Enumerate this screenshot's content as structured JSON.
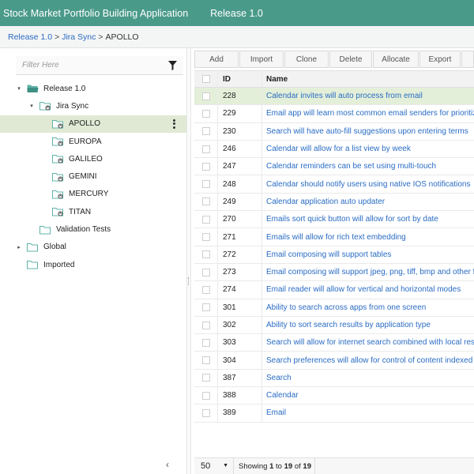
{
  "header": {
    "app_title": "Stock Market Portfolio Building Application",
    "release": "Release 1.0",
    "bg_color": "#4a9a8a"
  },
  "breadcrumb": {
    "items": [
      "Release 1.0",
      "Jira Sync"
    ],
    "separator": ">",
    "current": "APOLLO"
  },
  "filter": {
    "placeholder": "Filter Here",
    "icon": "filter-icon"
  },
  "tree": [
    {
      "label": "Release 1.0",
      "level": 0,
      "expanded": true,
      "icon": "folder-open-icon"
    },
    {
      "label": "Jira Sync",
      "level": 1,
      "expanded": true,
      "icon": "folder-sync-icon"
    },
    {
      "label": "APOLLO",
      "level": 2,
      "selected": true,
      "icon": "folder-sync-icon"
    },
    {
      "label": "EUROPA",
      "level": 2,
      "icon": "folder-sync-icon"
    },
    {
      "label": "GALILEO",
      "level": 2,
      "icon": "folder-sync-icon"
    },
    {
      "label": "GEMINI",
      "level": 2,
      "icon": "folder-sync-icon"
    },
    {
      "label": "MERCURY",
      "level": 2,
      "icon": "folder-sync-icon"
    },
    {
      "label": "TITAN",
      "level": 2,
      "icon": "folder-sync-icon"
    },
    {
      "label": "Validation Tests",
      "level": 1,
      "icon": "folder-icon"
    },
    {
      "label": "Global",
      "level": 0,
      "expanded": false,
      "icon": "folder-icon"
    },
    {
      "label": "Imported",
      "level": 0,
      "icon": "folder-icon"
    }
  ],
  "toolbar": {
    "add": "Add",
    "import": "Import",
    "clone": "Clone",
    "delete": "Delete",
    "allocate": "Allocate",
    "export": "Export"
  },
  "table": {
    "columns": {
      "id": "ID",
      "name": "Name"
    },
    "rows": [
      {
        "id": "228",
        "name": "Calendar invites will auto process from email",
        "highlight": true
      },
      {
        "id": "229",
        "name": "Email app will learn most common email senders for prioritization"
      },
      {
        "id": "230",
        "name": "Search will have auto-fill suggestions upon entering terms"
      },
      {
        "id": "246",
        "name": "Calendar will allow for a list view by week"
      },
      {
        "id": "247",
        "name": "Calendar reminders can be set using multi-touch"
      },
      {
        "id": "248",
        "name": "Calendar should notify users using native IOS notifications"
      },
      {
        "id": "249",
        "name": "Calendar application auto updater"
      },
      {
        "id": "270",
        "name": "Emails sort quick button will allow for sort by date"
      },
      {
        "id": "271",
        "name": "Emails will allow for rich text embedding"
      },
      {
        "id": "272",
        "name": "Email composing will support tables"
      },
      {
        "id": "273",
        "name": "Email composing will support jpeg, png, tiff, bmp and other formats"
      },
      {
        "id": "274",
        "name": "Email reader will allow for vertical and horizontal modes"
      },
      {
        "id": "301",
        "name": "Ability to search across apps from one screen"
      },
      {
        "id": "302",
        "name": "Ability to sort search results by application type"
      },
      {
        "id": "303",
        "name": "Search will allow for internet search combined with local results"
      },
      {
        "id": "304",
        "name": "Search preferences will allow for control of content indexed"
      },
      {
        "id": "387",
        "name": "Search"
      },
      {
        "id": "388",
        "name": "Calendar"
      },
      {
        "id": "389",
        "name": "Email"
      }
    ]
  },
  "footer": {
    "page_size": "50",
    "showing_prefix": "Showing",
    "from": "1",
    "to_word": "to",
    "to": "19",
    "of_word": "of",
    "total": "19"
  },
  "colors": {
    "link": "#2a6cc4",
    "selected_bg": "#dfe9d4",
    "folder_teal": "#5fb3a8"
  }
}
